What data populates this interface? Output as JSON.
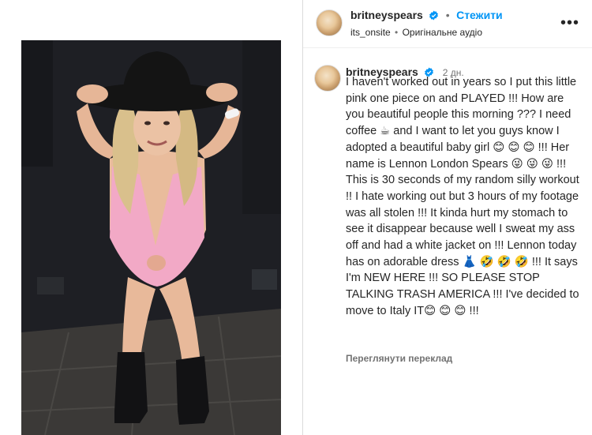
{
  "post": {
    "author": "britneyspears",
    "follow_label": "Стежити",
    "separator": "•",
    "audio_owner": "its_onsite",
    "audio_label": "Оригінальне аудіо",
    "menu_icon": "more-horizontal-icon"
  },
  "caption": {
    "author": "britneyspears",
    "time": "2 дн.",
    "text": "I haven't worked out in years so I put this little pink one piece on and PLAYED !!! How are you beautiful people this morning ??? I need coffee ☕ and I want to let you guys know I adopted a beautiful baby girl 😊 😊 😊 !!! Her name is Lennon London Spears 😜 😜 😜 !!! This is 30 seconds of my random silly workout !! I hate working out but 3 hours of my footage was all stolen !!! It kinda hurt my stomach to see it disappear because well I sweat my ass off and had a white jacket on !!!  Lennon today has on adorable dress 👗 🤣 🤣 🤣 !!! It says I'm NEW HERE !!! SO PLEASE STOP TALKING TRASH AMERICA !!! I've decided to move to Italy IT😊 😊 😊 !!!",
    "translate_label": "Переглянути переклад"
  },
  "colors": {
    "link_blue": "#0095f6",
    "verified_blue": "#0095f6",
    "secondary_text": "#737373",
    "swimsuit_pink": "#f2a9c6",
    "hat_black": "#141414"
  }
}
